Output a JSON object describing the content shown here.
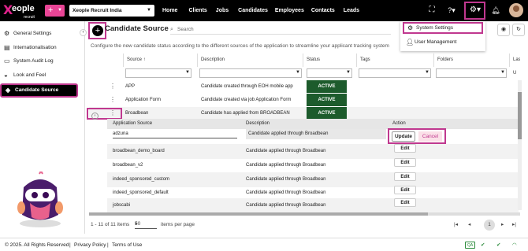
{
  "brand": {
    "x": "X",
    "word": "eople",
    "sub": "recruit"
  },
  "topbar": {
    "add_label": "+",
    "company": "Xeople Recruit India",
    "nav": [
      "Home",
      "Clients",
      "Jobs",
      "Candidates",
      "Employees",
      "Contacts",
      "Leads"
    ]
  },
  "settings_menu": {
    "items": [
      "System Settings",
      "User Management"
    ]
  },
  "sidebar": {
    "collapse": "‹",
    "items": [
      "General Settings",
      "Internationalisation",
      "System Audit Log",
      "Look and Feel",
      "Candidate Source"
    ]
  },
  "page": {
    "add": "+",
    "title": "Candidate Source",
    "search_placeholder": "Search",
    "subtitle": "Configure the new candidate status according to the different sources of the application to streamline your applicant tracking system"
  },
  "grid": {
    "headers": [
      "Source",
      "Description",
      "Status",
      "Tags",
      "Folders",
      "Last U"
    ],
    "sort_indicator": "↑",
    "rows": [
      {
        "source": "APP",
        "description": "Candidate created through EOH mobile app",
        "status": "ACTIVE"
      },
      {
        "source": "Application Form",
        "description": "Candidate created via job Application Form",
        "status": "ACTIVE"
      },
      {
        "source": "Broadbean",
        "description": "Candidate has applied from BROADBEAN",
        "status": "ACTIVE"
      }
    ],
    "sub_table": {
      "headers": [
        "Application Source",
        "Description",
        "Action"
      ],
      "edit_row": {
        "source": "adzuna",
        "description": "Candidate applied through Broadbean",
        "update": "Update",
        "cancel": "Cancel"
      },
      "rows": [
        {
          "source": "broadbean_demo_board",
          "description": "Candidate applied through Broadbean",
          "action": "Edit"
        },
        {
          "source": "broadbean_v2",
          "description": "Candidate applied through Broadbean",
          "action": "Edit"
        },
        {
          "source": "indeed_sponsored_custom",
          "description": "Candidate applied through Broadbean",
          "action": "Edit"
        },
        {
          "source": "indeed_sponsored_default",
          "description": "Candidate applied through Broadbean",
          "action": "Edit"
        },
        {
          "source": "jobscabi",
          "description": "Candidate applied through Broadbean",
          "action": "Edit"
        }
      ]
    }
  },
  "pager": {
    "range": "1 - 11 of 11 items",
    "page_size": "50",
    "per_page": "items per page",
    "current": "1"
  },
  "footer": {
    "copyright": "© 2025. All Rights Reserved",
    "privacy": "Privacy Policy",
    "terms": "Terms of Use",
    "sep": "|",
    "qa": "QA"
  },
  "colors": {
    "accent": "#e94596",
    "highlight": "#c0388f",
    "active_status": "#1d5b2c"
  }
}
